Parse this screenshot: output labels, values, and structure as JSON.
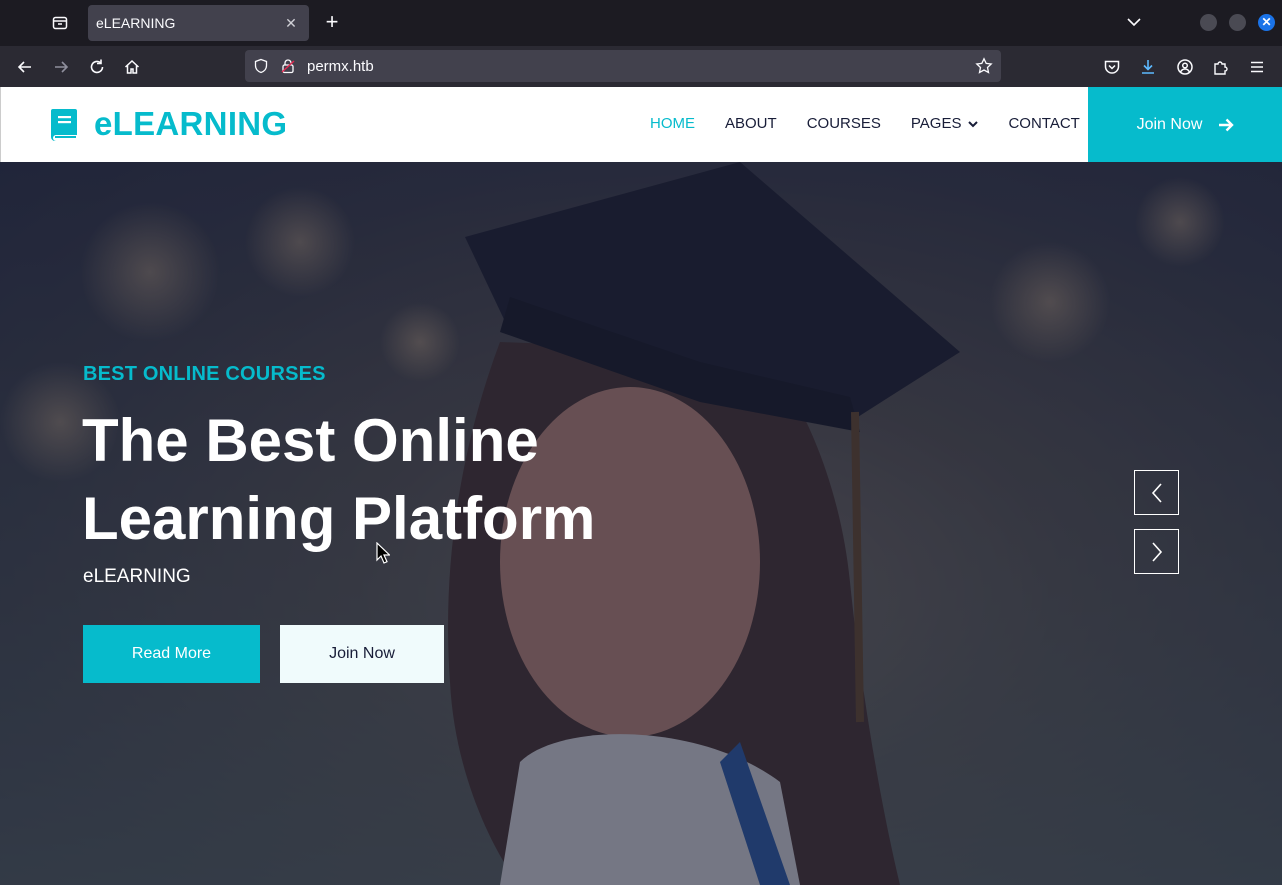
{
  "browser": {
    "tab_title": "eLEARNING",
    "url": "permx.htb",
    "tab_close_glyph": "✕",
    "new_tab_glyph": "+",
    "window_close_glyph": "✕",
    "icons": [
      "firefox-view-icon",
      "close-icon",
      "plus-icon",
      "chevron-down-icon",
      "back-icon",
      "forward-icon",
      "reload-icon",
      "home-icon",
      "shield-icon",
      "lock-icon",
      "star-icon",
      "pocket-icon",
      "download-icon",
      "account-icon",
      "extensions-icon",
      "hamburger-menu-icon"
    ]
  },
  "site": {
    "brand": "eLEARNING",
    "accent_color": "#06bbcc",
    "dark_color": "#181d38",
    "nav": {
      "items": [
        "HOME",
        "ABOUT",
        "COURSES",
        "PAGES",
        "CONTACT"
      ],
      "active": "HOME",
      "cta": "Join Now"
    },
    "hero": {
      "subtitle": "BEST ONLINE COURSES",
      "title": "The Best Online Learning Platform",
      "text": "eLEARNING",
      "primary_button": "Read More",
      "secondary_button": "Join Now"
    }
  }
}
